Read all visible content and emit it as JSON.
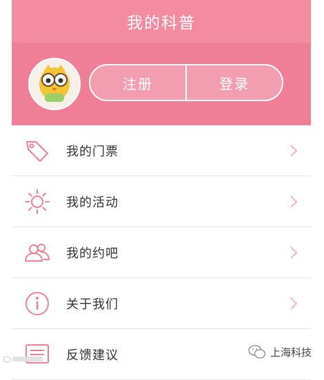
{
  "header": {
    "title": "我的科普"
  },
  "profile": {
    "register_label": "注册",
    "login_label": "登录"
  },
  "menu": {
    "items": [
      {
        "label": "我的门票",
        "icon": "ticket-tag-icon"
      },
      {
        "label": "我的活动",
        "icon": "sun-icon"
      },
      {
        "label": "我的约吧",
        "icon": "users-icon"
      },
      {
        "label": "关于我们",
        "icon": "info-icon"
      },
      {
        "label": "反馈建议",
        "icon": "feedback-icon"
      }
    ]
  },
  "watermark": {
    "right_text": "上海科技"
  },
  "colors": {
    "title_bar": "#f48ca0",
    "profile_bg": "#ee7f96",
    "icon_pink": "#ee7f96",
    "chevron": "#f2b6c3"
  }
}
